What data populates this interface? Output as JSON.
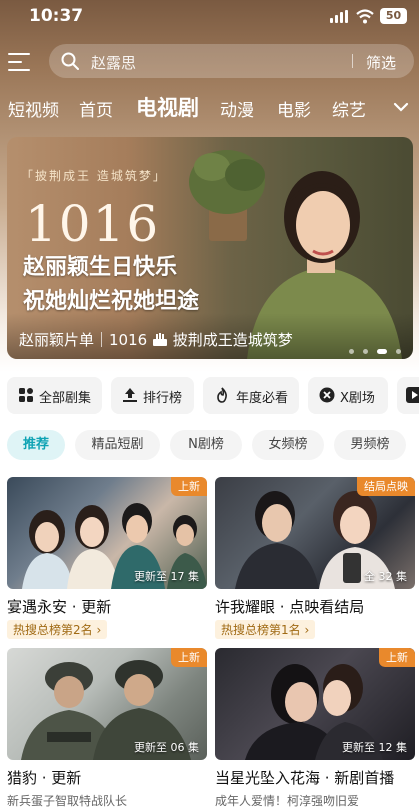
{
  "status_bar": {
    "time": "10:37",
    "battery": "50"
  },
  "search": {
    "placeholder": "赵露思",
    "filter_label": "筛选"
  },
  "channel_tabs": [
    "短视频",
    "首页",
    "电视剧",
    "动漫",
    "电影",
    "综艺"
  ],
  "active_tab": "电视剧",
  "banner": {
    "vertical_tag": "「披荆成王 造城筑梦」",
    "big_number": "1016",
    "headline_1": "赵丽颖生日快乐",
    "headline_2": "祝她灿烂祝她坦途",
    "caption_left": "赵丽颖片单｜1016",
    "caption_right": "披荆成王造城筑梦",
    "page_count": 4,
    "active_page": 3
  },
  "quick_entries": [
    {
      "label": "全部剧集",
      "icon": "grid-icon"
    },
    {
      "label": "排行榜",
      "icon": "ranking-icon"
    },
    {
      "label": "年度必看",
      "icon": "flame-icon"
    },
    {
      "label": "X剧场",
      "icon": "x-theater-icon"
    }
  ],
  "filter_chips": [
    "推荐",
    "精品短剧",
    "N剧榜",
    "女频榜",
    "男频榜"
  ],
  "cards": [
    {
      "title": "宴遇永安 · 更新",
      "subtitle": "热搜总榜第2名",
      "badge": "上新",
      "episode": "更新至 17 集"
    },
    {
      "title": "许我耀眼 · 点映看结局",
      "subtitle": "热搜总榜第1名",
      "badge": "结局点映",
      "episode": "全 32 集"
    },
    {
      "title": "猎豹 · 更新",
      "subtitle": "新兵蛋子智取特战队长",
      "badge": "上新",
      "episode": "更新至 06 集"
    },
    {
      "title": "当星光坠入花海 · 新剧首播",
      "subtitle": "成年人爱情！柯淳强吻旧爱",
      "badge": "上新",
      "episode": "更新至 12 集"
    }
  ],
  "colors": {
    "accent": "#0fa3b4",
    "badge": "#e9892c",
    "header_brown": "#7a5a41"
  }
}
